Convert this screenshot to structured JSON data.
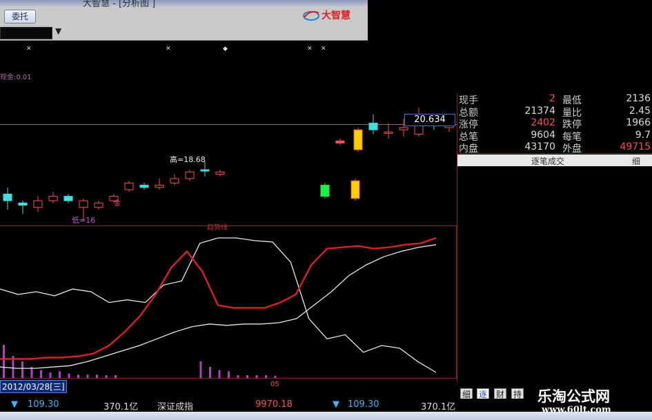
{
  "window": {
    "title": "大智慧 - [分析图 ]",
    "entrust_label": "委托",
    "logo_text": "大智慧"
  },
  "chart": {
    "ma_label": "现金:0.01",
    "high_label": "高=18.68",
    "low_label": "低=16",
    "current_price": "20.634",
    "date_label": "2012/03/28[三]",
    "bar_label": "05",
    "small_mark": "金",
    "indicator_title": "趋势线"
  },
  "quote": {
    "rows": [
      {
        "l1": "现手",
        "v1": "2",
        "l2": "最低",
        "v2": "2136",
        "v1class": "red",
        "v2class": ""
      },
      {
        "l1": "总额",
        "v1": "21374",
        "l2": "量比",
        "v2": "2.45",
        "v1class": "",
        "v2class": ""
      },
      {
        "l1": "涨停",
        "v1": "2402",
        "l2": "跌停",
        "v2": "1966",
        "v1class": "red",
        "v2class": ""
      },
      {
        "l1": "总笔",
        "v1": "9604",
        "l2": "每笔",
        "v2": "9.7",
        "v1class": "",
        "v2class": ""
      },
      {
        "l1": "内盘",
        "v1": "43170",
        "l2": "外盘",
        "v2": "49715",
        "v1class": "",
        "v2class": "red"
      }
    ],
    "ticks_title": "逐笔成交",
    "ticks_detail": "细"
  },
  "tabs": [
    "细",
    "逐",
    "财",
    "持"
  ],
  "status": {
    "arrow1": "▼",
    "change1": "109.30",
    "amount1": "370.1亿",
    "index_name": "深证成指",
    "index_value": "9970.18",
    "arrow2": "▼",
    "change2": "109.30",
    "amount2": "370.1亿"
  },
  "watermark": {
    "title": "乐淘公式网",
    "url": "www.60lt.com"
  },
  "colors": {
    "up": "#ff5050",
    "down": "#40e0e0",
    "panel_border": "#8b2020",
    "volume": "#b040c0"
  },
  "chart_data": {
    "candles": [
      {
        "o": 17.2,
        "h": 17.5,
        "c": 16.9,
        "l": 16.5,
        "type": "down"
      },
      {
        "o": 16.7,
        "h": 16.9,
        "c": 16.8,
        "l": 16.3,
        "type": "down"
      },
      {
        "o": 16.6,
        "h": 17.1,
        "c": 16.9,
        "l": 16.4,
        "type": "up"
      },
      {
        "o": 16.9,
        "h": 17.3,
        "c": 17.1,
        "l": 16.8,
        "type": "up"
      },
      {
        "o": 17.1,
        "h": 17.2,
        "c": 16.9,
        "l": 16.8,
        "type": "down"
      },
      {
        "o": 16.6,
        "h": 17.0,
        "c": 16.9,
        "l": 16.0,
        "type": "up"
      },
      {
        "o": 16.6,
        "h": 16.9,
        "c": 16.8,
        "l": 16.5,
        "type": "up"
      },
      {
        "o": 16.9,
        "h": 17.2,
        "c": 17.1,
        "l": 16.8,
        "type": "up"
      },
      {
        "o": 17.4,
        "h": 17.8,
        "c": 17.7,
        "l": 17.3,
        "type": "up"
      },
      {
        "o": 17.6,
        "h": 17.7,
        "c": 17.5,
        "l": 17.4,
        "type": "down"
      },
      {
        "o": 17.5,
        "h": 17.9,
        "c": 17.6,
        "l": 17.4,
        "type": "up"
      },
      {
        "o": 17.7,
        "h": 18.1,
        "c": 17.9,
        "l": 17.6,
        "type": "up"
      },
      {
        "o": 17.9,
        "h": 18.3,
        "c": 18.2,
        "l": 17.8,
        "type": "up"
      },
      {
        "o": 18.3,
        "h": 18.68,
        "c": 18.3,
        "l": 18.0,
        "type": "cross"
      },
      {
        "o": 18.1,
        "h": 18.3,
        "c": 18.2,
        "l": 18.0,
        "type": "up"
      },
      {
        "o": 17.1,
        "h": 17.7,
        "c": 17.6,
        "l": 17.0,
        "type": "green"
      },
      {
        "o": 19.6,
        "h": 19.7,
        "c": 19.5,
        "l": 19.4,
        "type": "gap"
      },
      {
        "o": 17.0,
        "h": 17.9,
        "c": 17.8,
        "l": 16.9,
        "type": "limit"
      },
      {
        "o": 19.2,
        "h": 20.2,
        "c": 20.1,
        "l": 19.1,
        "type": "yellow"
      },
      {
        "o": 20.4,
        "h": 20.8,
        "c": 20.1,
        "l": 19.9,
        "type": "down"
      },
      {
        "o": 20.0,
        "h": 20.4,
        "c": 20.0,
        "l": 19.7,
        "type": "up"
      },
      {
        "o": 20.1,
        "h": 20.6,
        "c": 20.2,
        "l": 19.8,
        "type": "up"
      },
      {
        "o": 19.9,
        "h": 21.1,
        "c": 20.6,
        "l": 19.8,
        "type": "up"
      },
      {
        "o": 20.4,
        "h": 20.5,
        "c": 20.4,
        "l": 20.1,
        "type": "down"
      },
      {
        "o": 20.2,
        "h": 20.5,
        "c": 20.4,
        "l": 20.0,
        "type": "up"
      },
      {
        "o": 20.5,
        "h": 20.7,
        "c": 20.6,
        "l": 20.3,
        "type": "up"
      },
      {
        "o": 20.7,
        "h": 21.5,
        "c": 21.4,
        "l": 20.6,
        "type": "up"
      },
      {
        "o": 21.3,
        "h": 21.7,
        "c": 21.4,
        "l": 21.0,
        "type": "up"
      }
    ],
    "price_range": [
      16,
      21.6
    ],
    "red_line": [
      10,
      10,
      10,
      11,
      11,
      12,
      14,
      20,
      30,
      42,
      58,
      78,
      90,
      75,
      50,
      48,
      48,
      48,
      52,
      58,
      80,
      92,
      93,
      94,
      92,
      93,
      95,
      96,
      100
    ],
    "white_line1": [
      62,
      58,
      60,
      57,
      62,
      60,
      52,
      54,
      52,
      65,
      68,
      96,
      100,
      100,
      98,
      97,
      82,
      40,
      25,
      28,
      15,
      20,
      18,
      8,
      0
    ],
    "white_line2": [
      4,
      3,
      3,
      4,
      5,
      8,
      12,
      16,
      20,
      25,
      30,
      34,
      36,
      35,
      36,
      36,
      37,
      40,
      50,
      60,
      72,
      80,
      86,
      90,
      93,
      95
    ],
    "volume": [
      60,
      40,
      30,
      20,
      14,
      10,
      12,
      8,
      6,
      6,
      6,
      5,
      5,
      30,
      20,
      14,
      12,
      5,
      5,
      5,
      5,
      4,
      4,
      3,
      3
    ]
  }
}
